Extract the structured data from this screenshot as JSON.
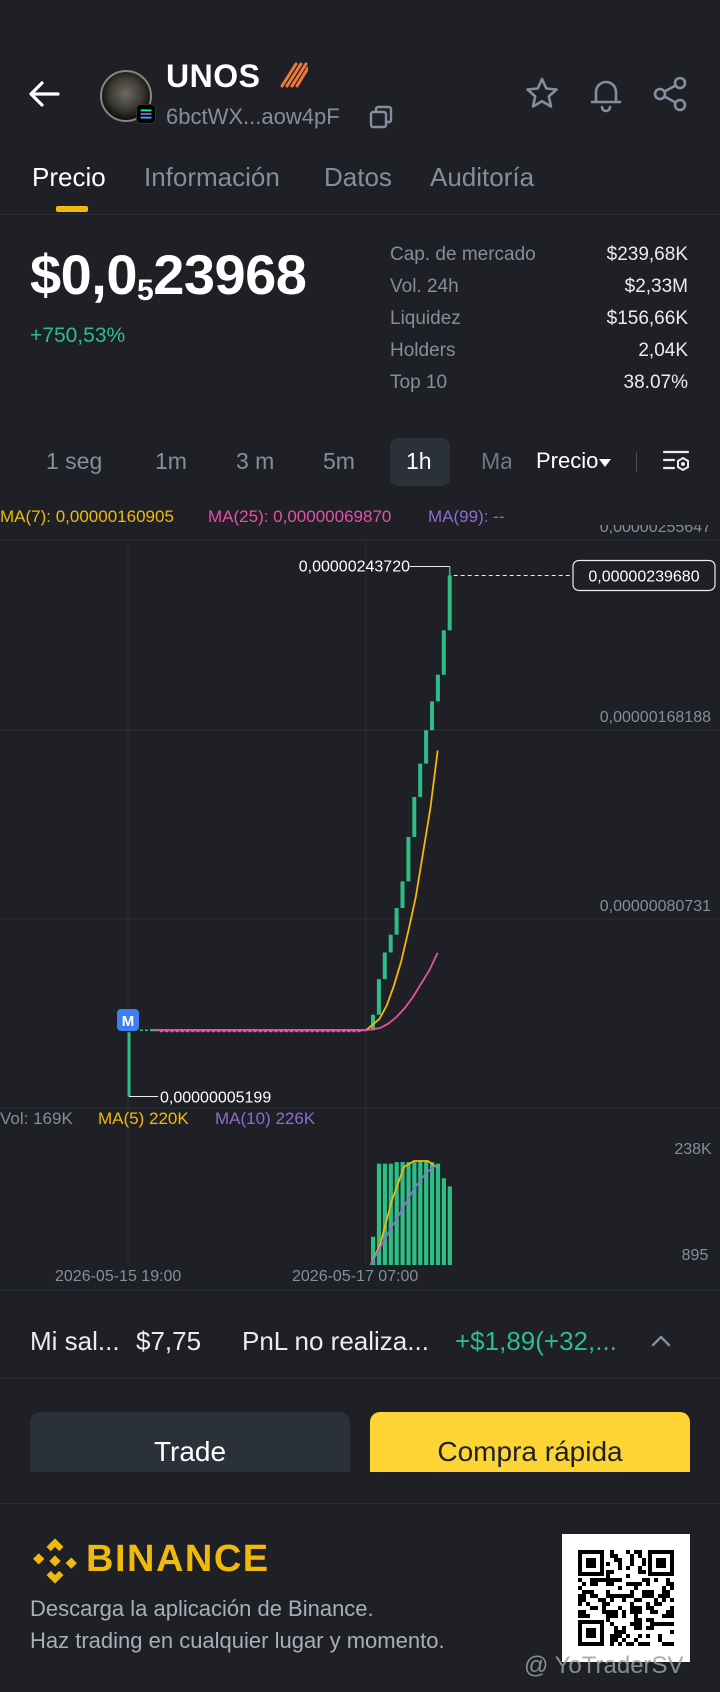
{
  "header": {
    "token_name": "UNOS",
    "address": "6bctWX...aow4pF",
    "icons": [
      "back-arrow-icon",
      "token-avatar",
      "solana-badge-icon",
      "flame-icon",
      "copy-icon",
      "star-icon",
      "bell-icon",
      "share-icon"
    ]
  },
  "tabs": [
    {
      "label": "Precio",
      "active": true
    },
    {
      "label": "Información",
      "active": false
    },
    {
      "label": "Datos",
      "active": false
    },
    {
      "label": "Auditoría",
      "active": false
    }
  ],
  "price": {
    "prefix": "$0,0",
    "zeros_sub": "5",
    "digits": "23968",
    "change": "+750,53%"
  },
  "stats": [
    {
      "label": "Cap. de mercado",
      "value": "$239,68K"
    },
    {
      "label": "Vol. 24h",
      "value": "$2,33M"
    },
    {
      "label": "Liquidez",
      "value": "$156,66K"
    },
    {
      "label": "Holders",
      "value": "2,04K"
    },
    {
      "label": "Top 10",
      "value": "38.07%"
    }
  ],
  "intervals": [
    "1 seg",
    "1m",
    "3 m",
    "5m",
    "1h",
    "Ma"
  ],
  "active_interval": "1h",
  "price_dropdown": "Precio",
  "ma_legend": {
    "ma7": "MA(7): 0,00000160905",
    "ma25": "MA(25): 0,00000069870",
    "ma99": "MA(99): --"
  },
  "vol_legend": {
    "vol": "Vol: 169K",
    "ma5": "MA(5) 220K",
    "ma10": "MA(10) 226K"
  },
  "colors": {
    "background": "#1e2026",
    "up": "#2ebd85",
    "accent": "#f0b90b",
    "ma7": "#f0b90b",
    "ma25": "#e84fa5",
    "ma99": "#8e6cd3",
    "button_buy": "#fcd535"
  },
  "chart_data": {
    "type": "candlestick",
    "y_axis_labels": [
      "0,00000255647",
      "0,00000168188",
      "0,00000080731"
    ],
    "ylim": [
      0.0,
      2.55647e-06
    ],
    "current_price_label": "0,00000239680",
    "high_label": "0,00000243720",
    "low_label": "0,00000005199",
    "marker_label": "M",
    "x_axis_labels": [
      "2026-05-15 19:00",
      "2026-05-17 07:00"
    ],
    "volume_axis_labels": [
      "238K",
      "895"
    ],
    "flat_price": 3.5e-07,
    "flat_candles": 39,
    "rally_candles": [
      {
        "o": 3.5e-07,
        "c": 4.2e-07
      },
      {
        "o": 4.2e-07,
        "c": 5.8e-07
      },
      {
        "o": 5.8e-07,
        "c": 7e-07
      },
      {
        "o": 7e-07,
        "c": 7.8e-07
      },
      {
        "o": 7.8e-07,
        "c": 9e-07
      },
      {
        "o": 9e-07,
        "c": 1.02e-06
      },
      {
        "o": 1.02e-06,
        "c": 1.22e-06
      },
      {
        "o": 1.22e-06,
        "c": 1.4e-06
      },
      {
        "o": 1.4e-06,
        "c": 1.55e-06
      },
      {
        "o": 1.55e-06,
        "c": 1.7e-06
      },
      {
        "o": 1.7e-06,
        "c": 1.83e-06
      },
      {
        "o": 1.83e-06,
        "c": 1.95e-06
      },
      {
        "o": 1.95e-06,
        "c": 2.15e-06
      },
      {
        "o": 2.15e-06,
        "c": 2.3968e-06
      }
    ],
    "rally_volumes": [
      60,
      205,
      205,
      205,
      208,
      208,
      208,
      208,
      210,
      210,
      208,
      205,
      176,
      160
    ],
    "volume_max": 238
  },
  "bottom_bar": {
    "balance_label": "Mi sal...",
    "balance_value": "$7,75",
    "pnl_label": "PnL no realiza...",
    "pnl_value": "+$1,89(+32,..."
  },
  "buttons": {
    "trade": "Trade",
    "quick_buy": "Compra rápida"
  },
  "footer": {
    "brand": "BINANCE",
    "line1": "Descarga la aplicación de Binance.",
    "line2": "Haz trading en cualquier lugar y momento.",
    "watermark": "@ YoTraderSV"
  }
}
